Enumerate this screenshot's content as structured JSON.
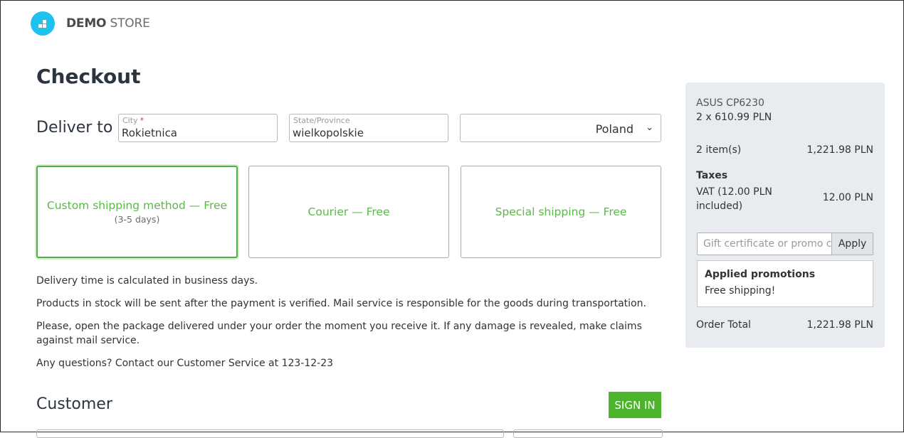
{
  "brand": {
    "name_bold": "DEMO",
    "name_light": "STORE"
  },
  "page_title": "Checkout",
  "deliver": {
    "label": "Deliver to",
    "city": {
      "label": "City",
      "required_mark": "*",
      "value": "Rokietnica"
    },
    "state": {
      "label": "State/Province",
      "value": "wielkopolskie"
    },
    "country": {
      "value": "Poland"
    }
  },
  "shipping_methods": [
    {
      "name": "Custom shipping method — Free",
      "days": "(3-5 days)",
      "selected": true
    },
    {
      "name": "Courier — Free",
      "days": "",
      "selected": false
    },
    {
      "name": "Special shipping — Free",
      "days": "",
      "selected": false
    }
  ],
  "info": [
    "Delivery time is calculated in business days.",
    "Products in stock will be sent after the payment is verified. Mail service is responsible for the goods during transportation.",
    "Please, open the package delivered under your order the moment you receive it. If any damage is revealed, make claims against mail service.",
    "Any questions? Contact our Customer Service at 123-12-23"
  ],
  "customer": {
    "heading": "Customer",
    "sign_in": "SIGN IN"
  },
  "summary": {
    "product_name": "ASUS CP6230",
    "product_qty_price": "2 x 610.99 PLN",
    "items_label": "2 item(s)",
    "items_value": "1,221.98 PLN",
    "taxes_heading": "Taxes",
    "vat_label": "VAT (12.00 PLN included)",
    "vat_value": "12.00 PLN",
    "promo_placeholder": "Gift certificate or promo code",
    "apply_label": "Apply",
    "applied_heading": "Applied promotions",
    "applied_text": "Free shipping!",
    "total_label": "Order Total",
    "total_value": "1,221.98 PLN"
  },
  "colors": {
    "accent_green": "#4ab52b",
    "shipping_text": "#5cb84a",
    "logo_blue": "#1fc1ee",
    "summary_bg": "#e8ebef"
  }
}
